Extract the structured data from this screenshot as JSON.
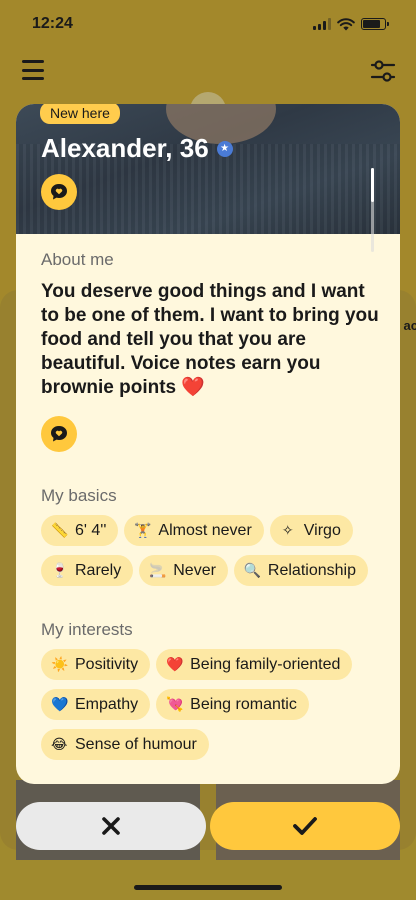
{
  "status_bar": {
    "time": "12:24"
  },
  "background": {
    "side_text": "ac"
  },
  "profile": {
    "badge": "New here",
    "name_age": "Alexander, 36",
    "verified_icon": "verified-star-icon",
    "about": {
      "title": "About me",
      "text": "You deserve good things and I want to be one of them. I want to bring you food and tell you that you are beautiful. Voice notes earn you brownie points ❤️"
    },
    "basics": {
      "title": "My basics",
      "items": [
        {
          "icon": "ruler-icon",
          "label": "6' 4''"
        },
        {
          "icon": "dumbbell-icon",
          "label": "Almost never"
        },
        {
          "icon": "zodiac-icon",
          "label": "Virgo"
        },
        {
          "icon": "drink-icon",
          "label": "Rarely"
        },
        {
          "icon": "smoking-icon",
          "label": "Never"
        },
        {
          "icon": "search-icon",
          "label": "Relationship"
        }
      ]
    },
    "interests": {
      "title": "My interests",
      "items": [
        {
          "emoji": "☀️",
          "label": "Positivity"
        },
        {
          "emoji": "❤️",
          "label": "Being family-oriented"
        },
        {
          "emoji": "💙",
          "label": "Empathy"
        },
        {
          "emoji": "💘",
          "label": "Being romantic"
        },
        {
          "emoji": "😂",
          "label": "Sense of humour"
        }
      ]
    }
  },
  "actions": {
    "pass_icon": "close-icon",
    "like_icon": "check-icon"
  },
  "colors": {
    "accent": "#ffc83d",
    "chip": "#fde8a4",
    "card": "#fff8dd",
    "verified": "#4a7bd6"
  }
}
